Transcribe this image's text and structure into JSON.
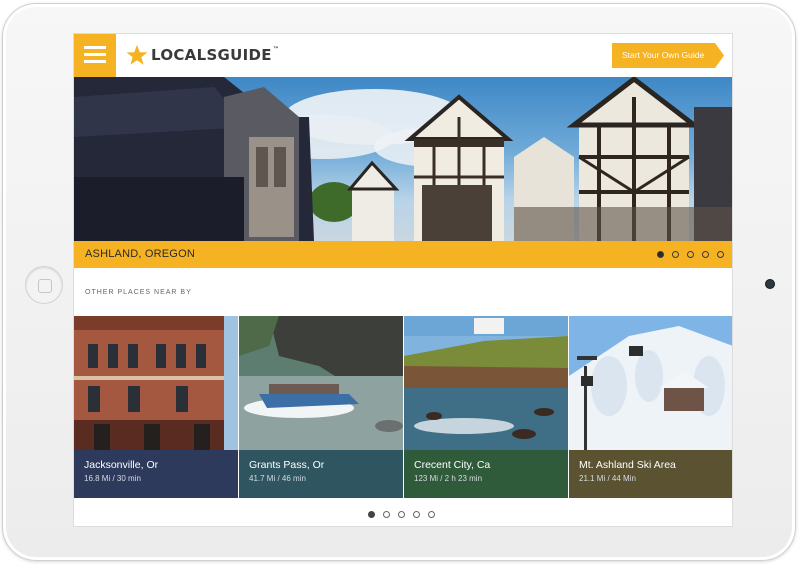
{
  "app": {
    "logo_text": "LOCALSGUIDE",
    "logo_tm": "™",
    "cta_label": "Start Your Own Guide",
    "brand_color": "#f5b324"
  },
  "hero": {
    "location": "ASHLAND, OREGON",
    "slide_count": 5,
    "active_slide": 1
  },
  "nearby": {
    "section_title": "OTHER PLACES NEAR BY",
    "places": [
      {
        "name": "Jacksonville, Or",
        "distance": "16.8 Mi / 30 min",
        "color": "#2d3a5c"
      },
      {
        "name": "Grants Pass, Or",
        "distance": "41.7 Mi / 46 min",
        "color": "#2e5560"
      },
      {
        "name": "Crecent City, Ca",
        "distance": "123 Mi / 2 h 23 min",
        "color": "#2f5b3b"
      },
      {
        "name": "Mt. Ashland Ski Area",
        "distance": "21.1 Mi / 44 Min",
        "color": "#5a5230"
      }
    ],
    "page_count": 5,
    "active_page": 1
  },
  "icons": {
    "menu": "hamburger-menu-icon",
    "logo": "star-icon"
  }
}
